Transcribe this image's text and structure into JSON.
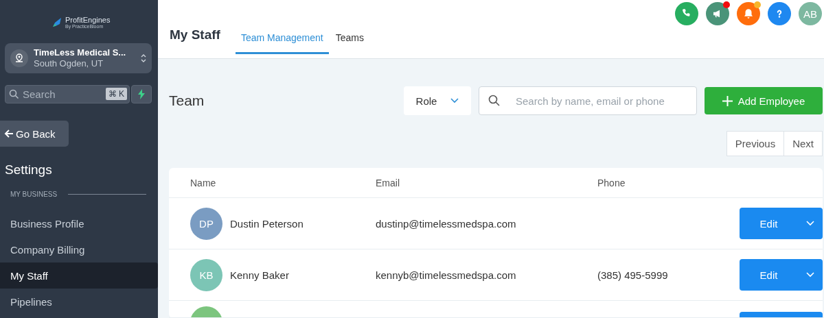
{
  "sidebar": {
    "logo": {
      "name": "ProfitEngines",
      "tagline": "By PracticeBloom"
    },
    "location": {
      "name": "TimeLess Medical S...",
      "address": "South Ogden, UT"
    },
    "search": {
      "placeholder": "Search",
      "shortcut": "⌘ K"
    },
    "back_button": "Go Back",
    "title": "Settings",
    "section": "MY BUSINESS",
    "items": [
      {
        "label": "Business Profile",
        "selected": false
      },
      {
        "label": "Company Billing",
        "selected": false
      },
      {
        "label": "My Staff",
        "selected": true
      },
      {
        "label": "Pipelines",
        "selected": false
      }
    ]
  },
  "header_icons": [
    {
      "kind": "phone",
      "color": "#27ae60"
    },
    {
      "kind": "megaphone",
      "color": "#4a9479",
      "badge": {
        "color": "#f20d0d"
      }
    },
    {
      "kind": "bell",
      "color": "#ff6d0c",
      "badge": {
        "color": "#f7b52c"
      }
    },
    {
      "kind": "help",
      "color": "#1e88f0"
    },
    {
      "kind": "avatar",
      "color": "#7db8a0",
      "label": "AB"
    }
  ],
  "page_title": "My Staff",
  "tabs": [
    {
      "label": "Team Management",
      "selected": true
    },
    {
      "label": "Teams",
      "selected": false
    }
  ],
  "section_title": "Team",
  "role_filter": "Role",
  "search": {
    "placeholder": "Search by name, email or phone"
  },
  "add_button": "Add Employee",
  "pagination": [
    "Previous",
    "Next"
  ],
  "table": {
    "columns": [
      "Name",
      "Email",
      "Phone"
    ],
    "rows": [
      {
        "kind": "full",
        "initials": "DP",
        "color": "#7a9cc2",
        "name": "Dustin Peterson",
        "email": "dustinp@timelessmedspa.com",
        "action": "Edit"
      },
      {
        "kind": "full",
        "initials": "KB",
        "color": "#7cc5b5",
        "name": "Kenny Baker",
        "email": "kennyb@timelessmedspa.com",
        "phone": "(385) 495-5999",
        "action": "Edit"
      },
      {
        "kind": "partial",
        "color": "#7cc57e"
      }
    ]
  }
}
